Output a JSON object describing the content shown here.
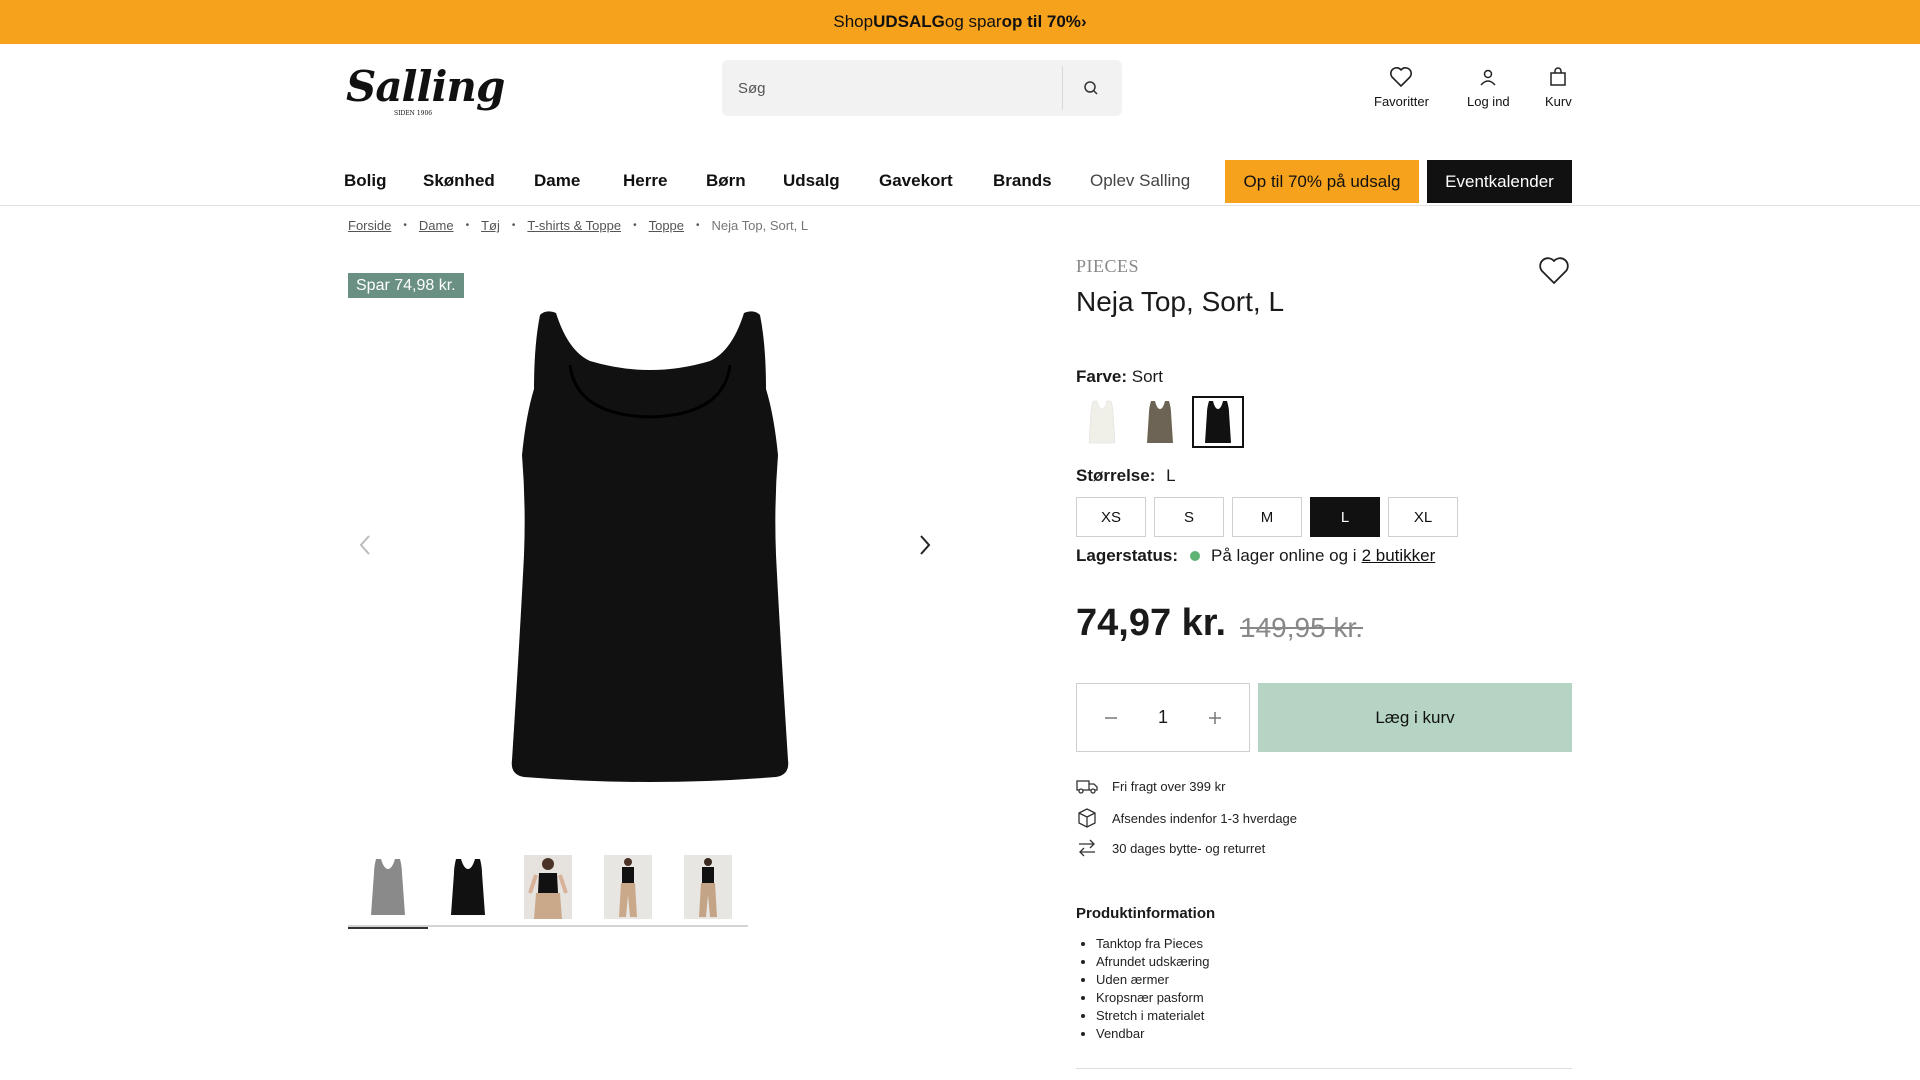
{
  "promo": {
    "pre": "Shop ",
    "bold1": "UDSALG",
    "mid": " og spar ",
    "bold2": "op til 70%",
    "arrow": " ›"
  },
  "header": {
    "logo": "Salling",
    "logo_sub": "SIDEN 1906",
    "search_placeholder": "Søg",
    "actions": {
      "favorites": "Favoritter",
      "login": "Log ind",
      "cart": "Kurv"
    }
  },
  "nav": {
    "items": [
      "Bolig",
      "Skønhed",
      "Dame",
      "Herre",
      "Børn",
      "Udsalg",
      "Gavekort",
      "Brands",
      "Oplev Salling"
    ],
    "promo": "Op til 70% på udsalg",
    "event": "Eventkalender"
  },
  "breadcrumb": [
    "Forside",
    "Dame",
    "Tøj",
    "T-shirts & Toppe",
    "Toppe",
    "Neja Top, Sort, L"
  ],
  "product": {
    "badge": "Spar 74,98 kr.",
    "brand": "PIECES",
    "title": "Neja Top, Sort, L",
    "color_label": "Farve:",
    "color_value": "Sort",
    "swatch_colors": [
      "#f1f0e8",
      "#6e6455",
      "#111111"
    ],
    "size_label": "Størrelse:",
    "size_value": "L",
    "sizes": [
      "XS",
      "S",
      "M",
      "L",
      "XL"
    ],
    "stock_label": "Lagerstatus:",
    "stock_text": "På lager online og i",
    "stock_link": "2 butikker",
    "price": "74,97 kr.",
    "old_price": "149,95 kr.",
    "quantity": "1",
    "add_to_cart": "Læg i kurv",
    "usps": [
      "Fri fragt over 399 kr",
      "Afsendes indenfor 1-3 hverdage",
      "30 dages bytte- og returret"
    ],
    "info_title": "Produktinformation",
    "info_items": [
      "Tanktop fra Pieces",
      "Afrundet udskæring",
      "Uden ærmer",
      "Kropsnær pasform",
      "Stretch i materialet",
      "Vendbar"
    ]
  },
  "colors": {
    "accent": "#f6a21c",
    "badge": "#6a9083",
    "add_to_cart": "#b5d4c4",
    "in_stock": "#5fb374"
  }
}
